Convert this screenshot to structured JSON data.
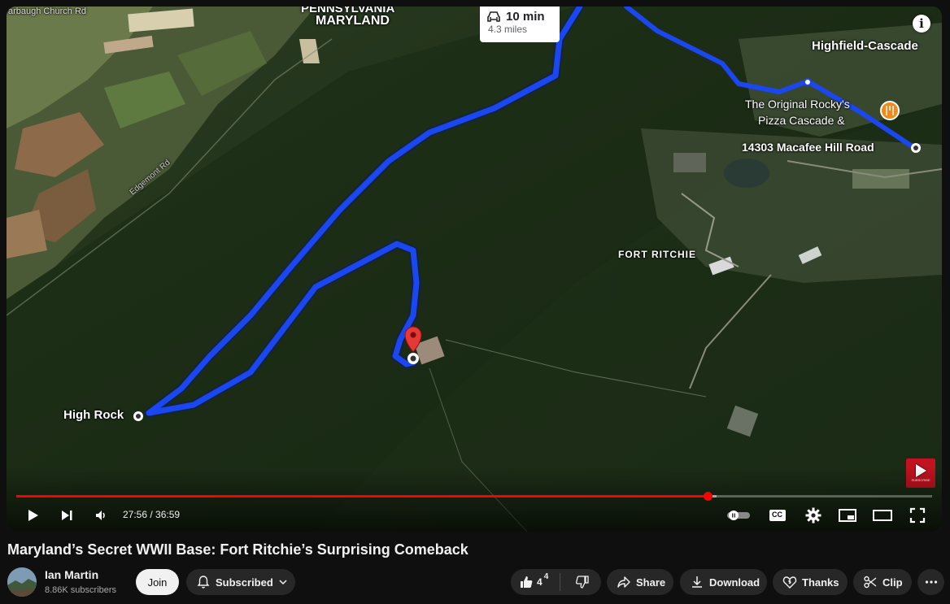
{
  "player": {
    "route_time": "10 min",
    "route_distance": "4.3 miles",
    "map_labels": {
      "state_pa": "PENNSYLVANIA",
      "state_md": "MARYLAND",
      "church_rd": "arbaugh Church Rd",
      "edgemont_rd": "Edgemont Rd",
      "highfield": "Highfield-Cascade",
      "pizza_line1": "The Original Rocky's",
      "pizza_line2": "Pizza Cascade &",
      "address": "14303 Macafee Hill Road",
      "fort_ritchie": "FORT RITCHIE",
      "high_rock": "High Rock"
    },
    "time_current": "27:56",
    "time_total": "36:59",
    "time_display": "27:56 / 36:59",
    "progress_fraction": 0.755,
    "loaded_fraction": 0.765,
    "watermark_text": "SUBSCRIBE",
    "info_label": "i",
    "cc_label": "CC"
  },
  "video": {
    "title": "Maryland’s Secret WWII Base: Fort Ritchie’s Surprising Comeback"
  },
  "channel": {
    "name": "Ian Martin",
    "subscribers": "8.86K subscribers"
  },
  "actions": {
    "join": "Join",
    "subscribed": "Subscribed",
    "like_count": "4",
    "like_badge": "4",
    "share": "Share",
    "download": "Download",
    "thanks": "Thanks",
    "clip": "Clip"
  },
  "colors": {
    "route_blue": "#1a47f0",
    "progress_red": "#ff0000",
    "pill_bg": "#272727",
    "page_bg": "#0f0f0f"
  }
}
